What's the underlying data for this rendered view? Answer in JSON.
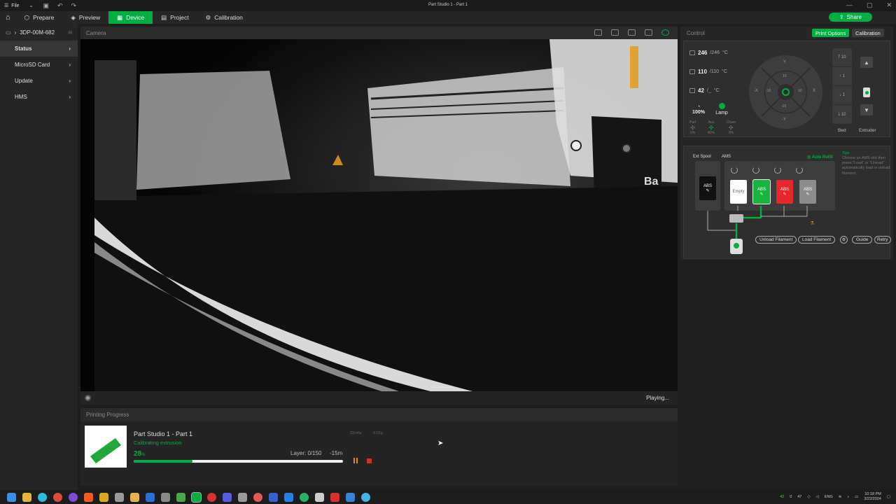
{
  "titlebar": {
    "menu": "File",
    "title": "Part Studio 1 - Part 1"
  },
  "tabs": [
    {
      "label": "Prepare"
    },
    {
      "label": "Preview"
    },
    {
      "label": "Device"
    },
    {
      "label": "Project"
    },
    {
      "label": "Calibration"
    }
  ],
  "share_label": "Share",
  "device": {
    "name": "3DP-00M-682"
  },
  "nav": [
    "Status",
    "MicroSD Card",
    "Update",
    "HMS"
  ],
  "camera": {
    "header": "Camera",
    "status": "Playing..."
  },
  "progress": {
    "header": "Printing Progress",
    "name": "Part Studio 1 - Part 1",
    "stage": "Calibrating extrusion",
    "percent": "28",
    "percent_unit": "%",
    "percent_value": 28,
    "time": "22m6s",
    "weight": "9.02g",
    "layer": "Layer: 0/150",
    "remaining": "-15m"
  },
  "control": {
    "header": "Control",
    "print_options": "Print Options",
    "calibration": "Calibration",
    "nozzle": {
      "current": "246",
      "target": "/246",
      "unit": "°C"
    },
    "bed": {
      "current": "110",
      "target": "/110",
      "unit": "°C"
    },
    "chamber": {
      "current": "42",
      "target": "/_",
      "unit": "°C"
    },
    "speed": "100%",
    "lamp": "Lamp",
    "fans": [
      {
        "label": "Part",
        "value": "0%"
      },
      {
        "label": "Aux",
        "value": "40%"
      },
      {
        "label": "Cham",
        "value": "0%"
      }
    ],
    "axes": {
      "y": "Y",
      "ny": "-Y",
      "x": "X",
      "nx": "-X",
      "y10": "10",
      "x10": "10",
      "ny10": "-10",
      "nx10": "-10"
    },
    "z": [
      "10",
      "1",
      "1",
      "10"
    ],
    "bed_label": "Bed",
    "extruder_label": "Extruder"
  },
  "ams": {
    "ext_spool": "Ext Spool",
    "ams_label": "AMS",
    "auto_refill": "Auto Refill",
    "tips_title": "Tips",
    "tips_text": "Choose an AMS slot then press \"Load\" or \"Unload\" automatically load or unload filament.",
    "ext": {
      "label": "ABS",
      "color": "#111111"
    },
    "slots": [
      {
        "label": "Empty",
        "color": "#ffffff",
        "text": "#666666"
      },
      {
        "label": "ABS",
        "color": "#18b43c",
        "text": "#ffffff"
      },
      {
        "label": "ABS",
        "color": "#e8262b",
        "text": "#ffffff"
      },
      {
        "label": "ABS",
        "color": "#8c8c8c",
        "text": "#ffffff"
      }
    ],
    "unload": "Unload Filament",
    "load": "Load Filament",
    "guide": "Guide",
    "retry": "Retry"
  },
  "taskbar": {
    "lang": "ENG",
    "time": "10:18 PM",
    "date": "3/22/2024",
    "tray_a": "42",
    "tray_b": "0",
    "tray_c": "47"
  }
}
